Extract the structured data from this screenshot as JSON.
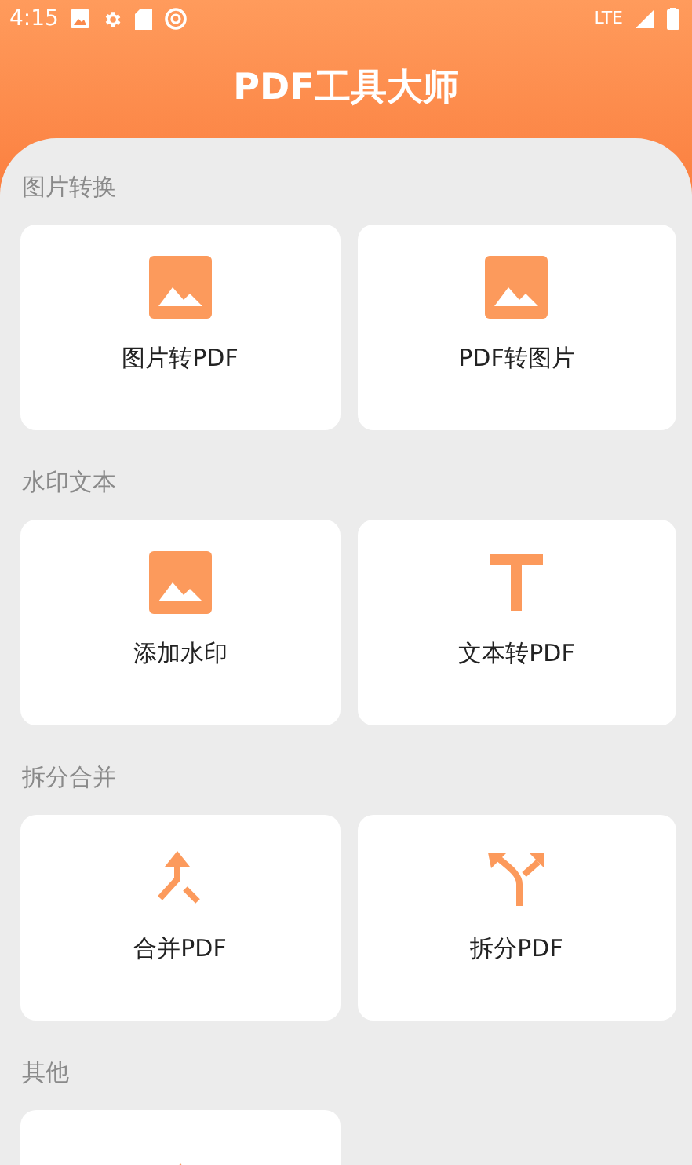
{
  "status_bar": {
    "time": "4:15",
    "network": "LTE"
  },
  "header": {
    "title": "PDF工具大师"
  },
  "sections": [
    {
      "title": "图片转换",
      "tools": [
        {
          "label": "图片转PDF",
          "kind": "image"
        },
        {
          "label": "PDF转图片",
          "kind": "image"
        }
      ]
    },
    {
      "title": "水印文本",
      "tools": [
        {
          "label": "添加水印",
          "kind": "image"
        },
        {
          "label": "文本转PDF",
          "kind": "text"
        }
      ]
    },
    {
      "title": "拆分合并",
      "tools": [
        {
          "label": "合并PDF",
          "kind": "merge"
        },
        {
          "label": "拆分PDF",
          "kind": "split"
        }
      ]
    },
    {
      "title": "其他",
      "tools": [
        {
          "kind": "up"
        }
      ]
    }
  ]
}
